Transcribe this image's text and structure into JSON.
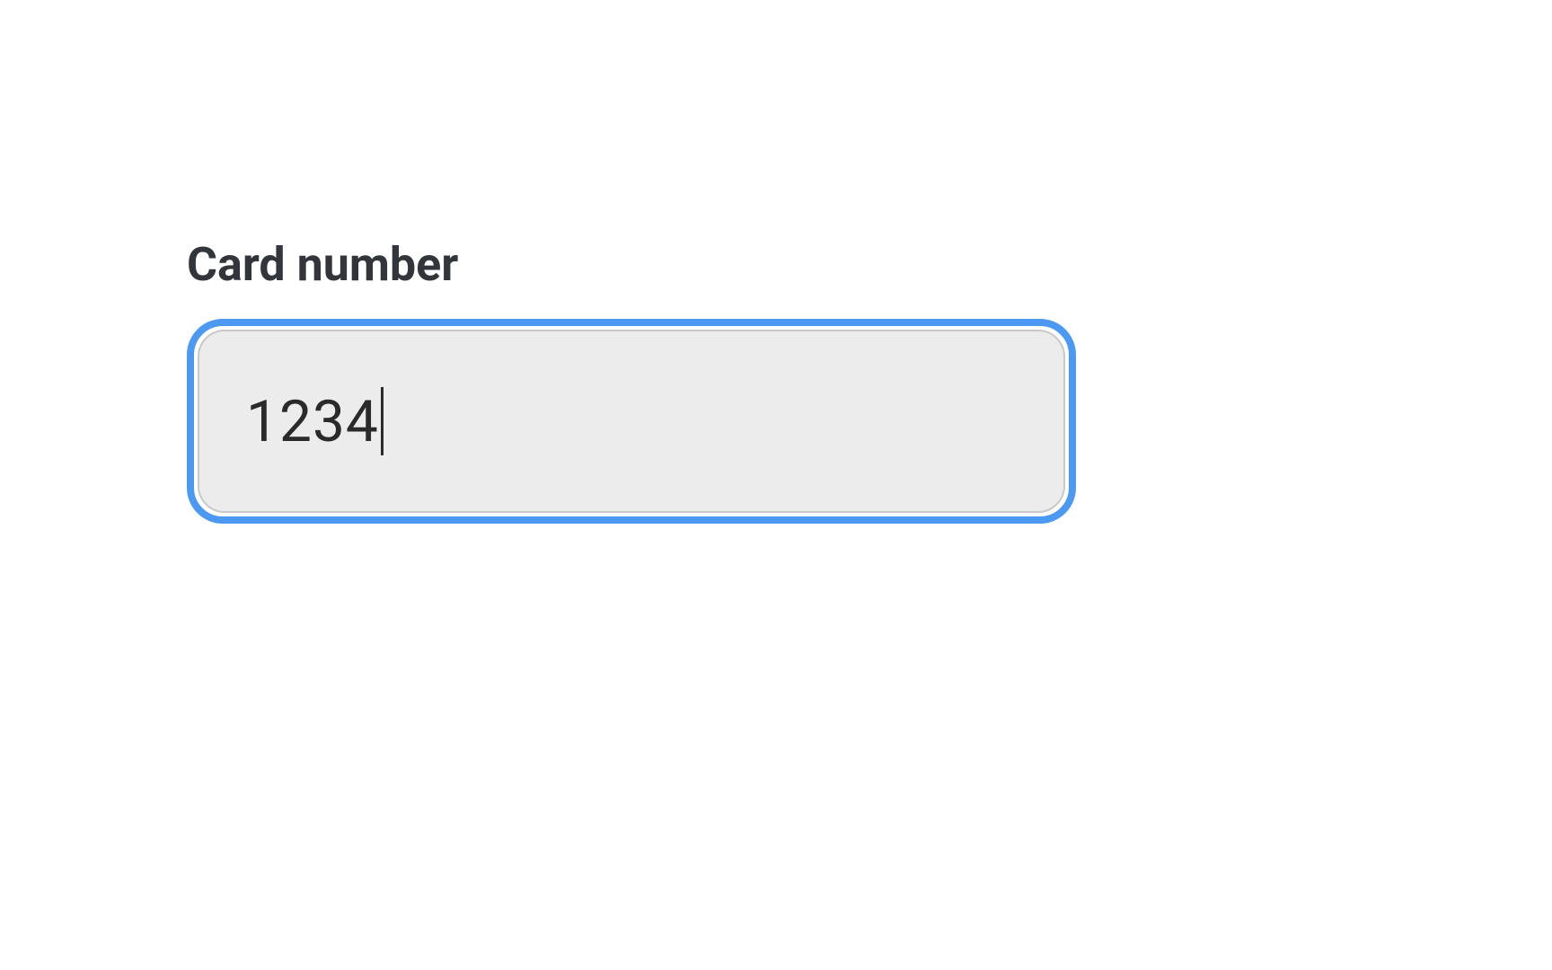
{
  "form": {
    "card_number": {
      "label": "Card number",
      "value": "1234"
    }
  }
}
